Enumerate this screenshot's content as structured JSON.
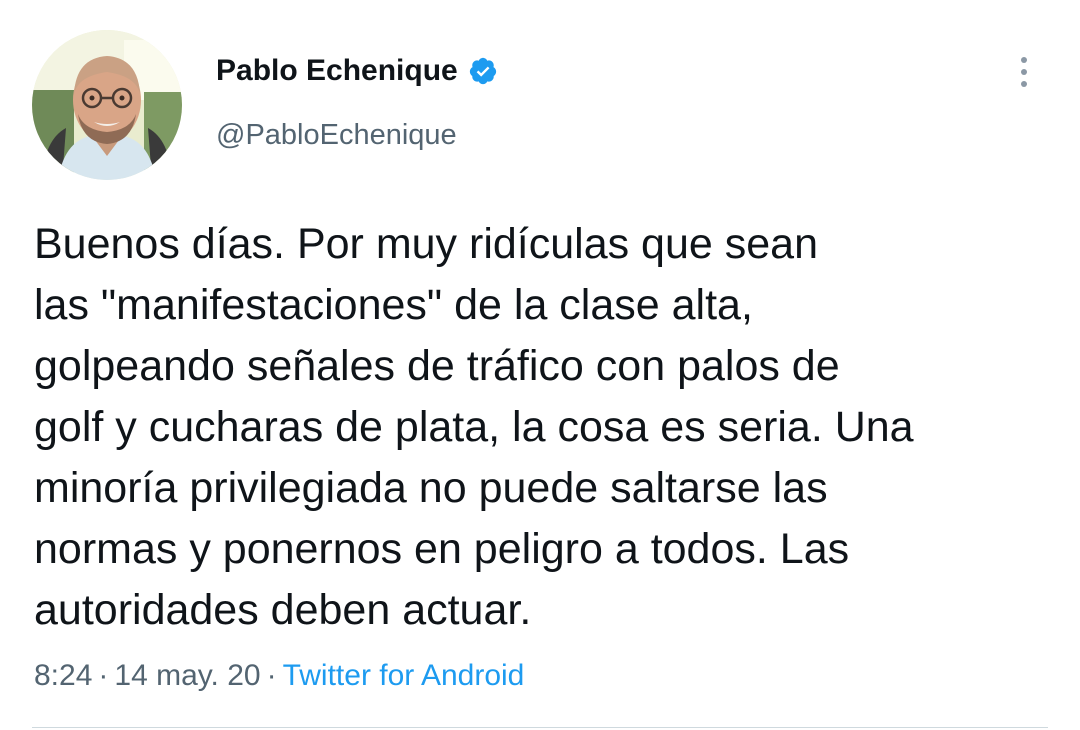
{
  "author": {
    "display_name": "Pablo Echenique",
    "handle": "@PabloEchenique",
    "verified": true,
    "avatar_icon": "profile-photo"
  },
  "tweet": {
    "text_lines": [
      "Buenos días. Por muy ridículas que sean",
      "las \"manifestaciones\" de la clase alta,",
      "golpeando señales de tráfico con palos de",
      "golf y cucharas de plata, la cosa es seria. Una",
      "minoría privilegiada no puede saltarse las",
      "normas y ponernos en peligro a todos. Las",
      "autoridades deben actuar."
    ],
    "time": "8:24",
    "date": "14 may. 20",
    "separator": "·",
    "source": "Twitter for Android"
  },
  "colors": {
    "text": "#0f1419",
    "secondary": "#536471",
    "accent": "#1d9bf0",
    "divider": "#cfd9de"
  },
  "icons": {
    "verified": "verified-badge-icon",
    "more": "more-vertical-icon"
  }
}
